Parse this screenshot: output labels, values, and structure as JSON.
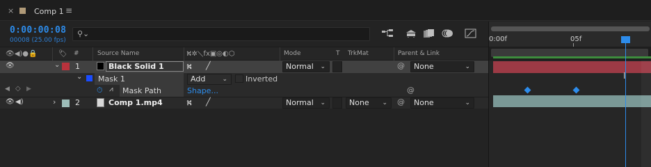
{
  "tab": {
    "close": "×",
    "title": "Comp 1",
    "menu": "≡"
  },
  "header": {
    "timecode": "0:00:00:08",
    "frames": "00008 (25.00 fps)",
    "search_placeholder": ""
  },
  "columns": {
    "source_name": "Source Name",
    "mode": "Mode",
    "t": "T",
    "trkmat": "TrkMat",
    "parent": "Parent & Link",
    "hash": "#"
  },
  "layers": [
    {
      "index": "1",
      "name": "Black Solid 1",
      "mode": "Normal",
      "parent": "None",
      "label_color": "#b8323c"
    },
    {
      "index": "2",
      "name": "Comp 1.mp4",
      "mode": "Normal",
      "trkmat": "None",
      "parent": "None",
      "label_color": "#9cbcb8"
    }
  ],
  "mask": {
    "name": "Mask 1",
    "mode": "Add",
    "inverted_label": "Inverted",
    "color": "#1a4cff"
  },
  "mask_path": {
    "label": "Mask Path",
    "value": "Shape..."
  },
  "ruler": {
    "start": "0:00f",
    "mark": "05f"
  },
  "colors": {
    "accent": "#2d8ceb",
    "red_layer": "#9c3a45",
    "teal_layer": "#7a9896"
  }
}
